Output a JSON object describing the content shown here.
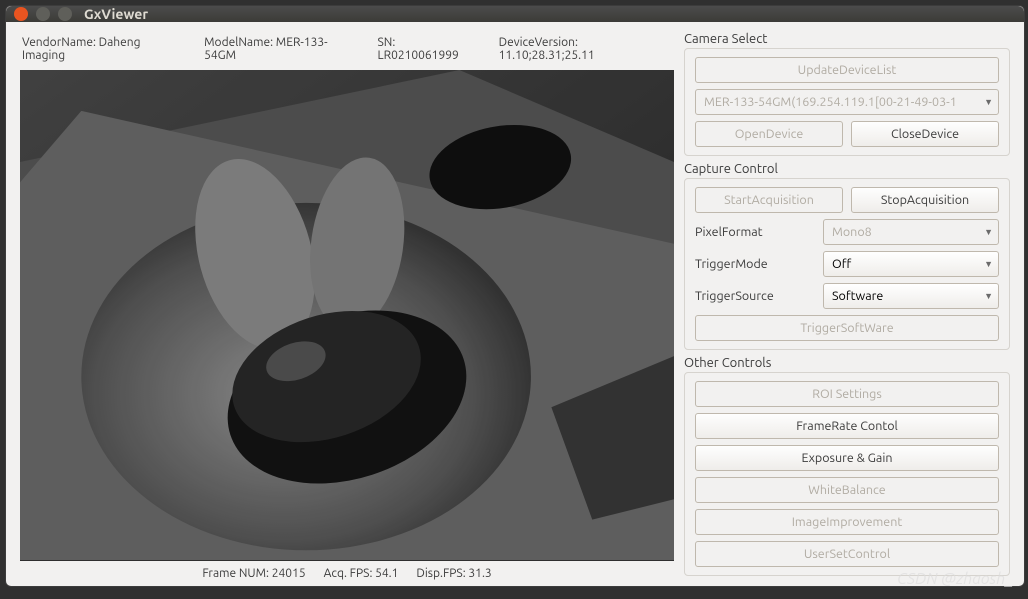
{
  "window": {
    "title": "GxViewer"
  },
  "info": {
    "vendor_label": "VendorName: Daheng Imaging",
    "model_label": "ModelName: MER-133-54GM",
    "sn_label": "SN: LR0210061999",
    "version_label": "DeviceVersion: 11.10;28.31;25.11"
  },
  "status": {
    "frame_num": "Frame NUM: 24015",
    "acq_fps": "Acq. FPS: 54.1",
    "disp_fps": "Disp.FPS: 31.3"
  },
  "camera_select": {
    "heading": "Camera Select",
    "update_label": "UpdateDeviceList",
    "device": "MER-133-54GM(169.254.119.1[00-21-49-03-1",
    "open_label": "OpenDevice",
    "close_label": "CloseDevice"
  },
  "capture": {
    "heading": "Capture Control",
    "start_label": "StartAcquisition",
    "stop_label": "StopAcquisition",
    "pixel_format_label": "PixelFormat",
    "pixel_format_value": "Mono8",
    "trigger_mode_label": "TriggerMode",
    "trigger_mode_value": "Off",
    "trigger_source_label": "TriggerSource",
    "trigger_source_value": "Software",
    "trigger_sw_label": "TriggerSoftWare"
  },
  "other": {
    "heading": "Other Controls",
    "roi_label": "ROI Settings",
    "framerate_label": "FrameRate Contol",
    "exposure_label": "Exposure & Gain",
    "wb_label": "WhiteBalance",
    "improve_label": "ImageImprovement",
    "userset_label": "UserSetControl"
  },
  "watermark": "CSDN @zhaosh_"
}
